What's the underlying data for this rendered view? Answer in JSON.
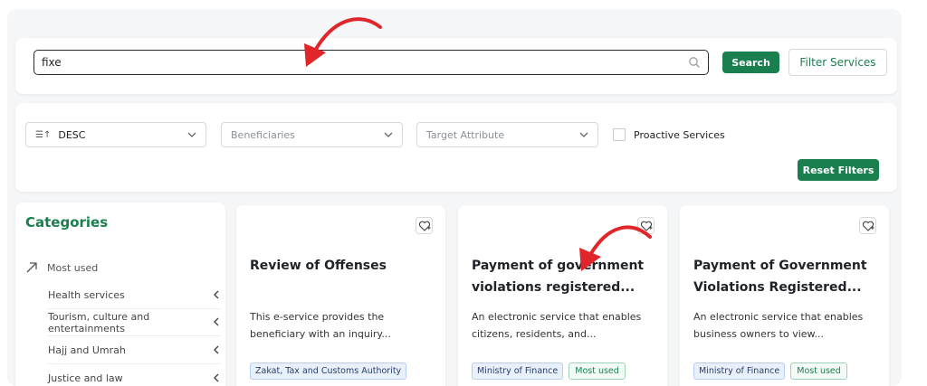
{
  "colors": {
    "accent": "#1a7f4e",
    "annotation_arrow": "#e0262a"
  },
  "search": {
    "value": "fixe",
    "search_button": "Search",
    "filter_button": "Filter Services",
    "icon": "search-icon"
  },
  "filters": {
    "sort_value": "DESC",
    "sort_icon": "sort-icon",
    "beneficiaries_placeholder": "Beneficiaries",
    "target_attribute_placeholder": "Target Attribute",
    "proactive_label": "Proactive Services",
    "proactive_checked": false,
    "reset_button": "Reset Filters"
  },
  "categories": {
    "title": "Categories",
    "most_used": "Most used",
    "items": [
      {
        "label": "Health services"
      },
      {
        "label": "Tourism, culture and entertainments"
      },
      {
        "label": "Hajj and Umrah"
      },
      {
        "label": "Justice and law"
      }
    ]
  },
  "cards": [
    {
      "title": "Review of Offenses",
      "description": "This e-service provides the beneficiary with an inquiry...",
      "tags": [
        "Zakat, Tax and Customs Authority"
      ]
    },
    {
      "title": "Payment of government violations registered...",
      "description": "An electronic service that enables citizens, residents, and...",
      "tags": [
        "Ministry of Finance",
        "Most used"
      ]
    },
    {
      "title": "Payment of Government Violations Registered...",
      "description": "An electronic service that enables business owners to view...",
      "tags": [
        "Ministry of Finance",
        "Most used"
      ]
    }
  ]
}
